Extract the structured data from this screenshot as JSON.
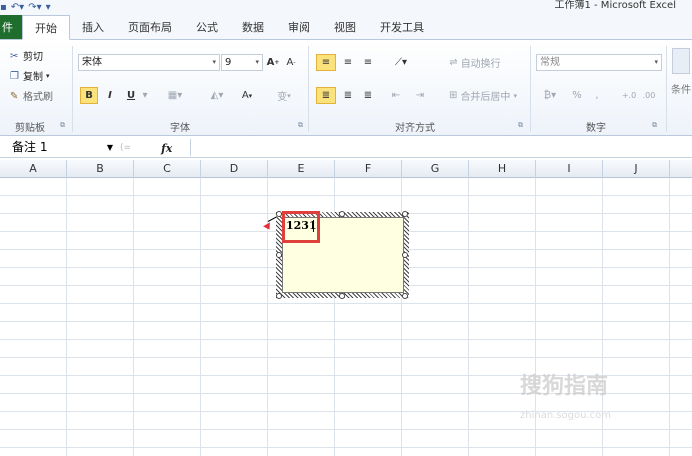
{
  "app": {
    "title": "工作簿1 - Microsoft Excel"
  },
  "ribbon_tabs": [
    {
      "label": "件"
    },
    {
      "label": "开始"
    },
    {
      "label": "插入"
    },
    {
      "label": "页面布局"
    },
    {
      "label": "公式"
    },
    {
      "label": "数据"
    },
    {
      "label": "审阅"
    },
    {
      "label": "视图"
    },
    {
      "label": "开发工具"
    }
  ],
  "clipboard": {
    "cut_label": "剪切",
    "copy_label": "复制",
    "format_painter_label": "格式刷",
    "group_label": "剪贴板"
  },
  "font": {
    "name": "宋体",
    "size": "9",
    "bold": "B",
    "italic": "I",
    "underline": "U",
    "font_color": "A",
    "phonetic": "变",
    "group_label": "字体"
  },
  "alignment": {
    "wrap_text_label": "自动换行",
    "merge_label": "合并后居中",
    "group_label": "对齐方式"
  },
  "number": {
    "format": "常规",
    "percent": "%",
    "comma": ",",
    "group_label": "数字"
  },
  "styles": {
    "partial_label": "条件"
  },
  "formula_bar": {
    "name_box": "备注 1",
    "fx": "fx"
  },
  "columns": [
    "A",
    "B",
    "C",
    "D",
    "E",
    "F",
    "G",
    "H",
    "I",
    "J"
  ],
  "comment": {
    "text": "1231"
  },
  "watermark": {
    "brand": "搜狗指南",
    "url": "zhinan.sogou.com"
  },
  "colors": {
    "file_tab": "#1f6e2d",
    "highlight_box": "#e0403c",
    "comment_fill": "#ffffe1",
    "active_button": "#fbe27a"
  }
}
